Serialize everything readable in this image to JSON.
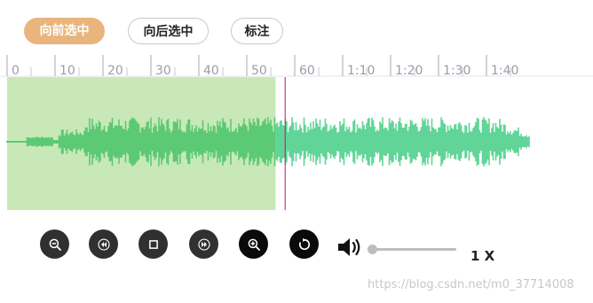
{
  "toolbar": {
    "select_forward": "向前选中",
    "select_backward": "向后选中",
    "mark": "标注"
  },
  "timeline": {
    "ticks": [
      "0",
      "10",
      "20",
      "30",
      "40",
      "50",
      "60",
      "1:10",
      "1:20",
      "1:30",
      "1:40"
    ],
    "selection_end_seconds": 56,
    "cursor_seconds": 58
  },
  "colors": {
    "selection": "#c8e8b7",
    "wave_selected": "#5cc975",
    "wave_unselected": "#60d597",
    "cursor": "#c2185b",
    "accent_button": "#e9b57d"
  },
  "controls": {
    "icons": [
      "zoom-out-icon",
      "skip-back-icon",
      "stop-icon",
      "skip-forward-icon",
      "zoom-in-icon",
      "replay-icon",
      "volume-icon"
    ],
    "volume_level": 0,
    "speed": "1 X"
  },
  "watermark": "https://blog.csdn.net/m0_37714008"
}
